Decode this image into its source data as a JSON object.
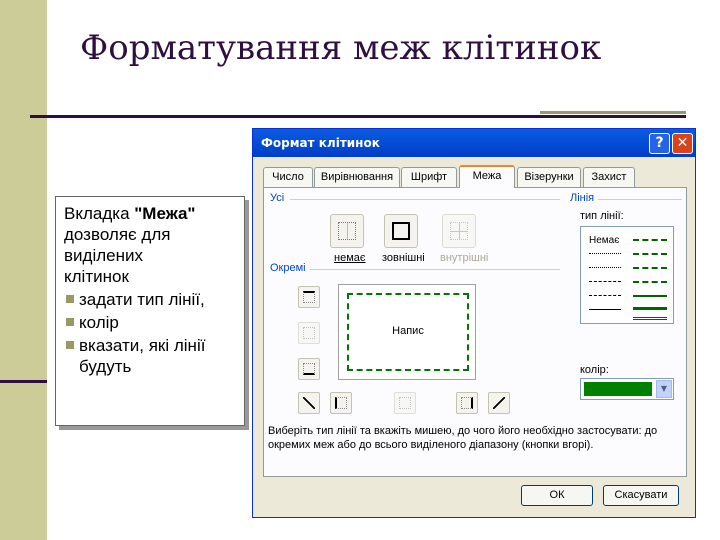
{
  "slide": {
    "title": "Форматування меж клітинок",
    "text_lines": [
      "Вкладка \"Межа\"",
      "дозволяє для",
      "виділених",
      "клітинок"
    ],
    "bullets": [
      "задати тип лінії,",
      "колір",
      "вказати, які лінії будуть"
    ]
  },
  "dialog": {
    "title": "Формат клітинок",
    "help": "?",
    "close": "✕",
    "tabs": [
      "Число",
      "Вирівнювання",
      "Шрифт",
      "Межа",
      "Візерунки",
      "Захист"
    ],
    "active_tab": "Межа",
    "group_all": "Усі",
    "group_separate": "Окремі",
    "group_line": "Лінія",
    "presets": [
      "немає",
      "зовнішні",
      "внутрішні"
    ],
    "preview_text": "Напис",
    "line_type_label": "тип лінії:",
    "line_none": "Немає",
    "color_label": "колір:",
    "color_value": "#008000",
    "hint": "Виберіть тип лінії та вкажіть мишею, до чого його необхідно застосувати: до окремих меж або до всього виділеного діапазону (кнопки вгорі).",
    "ok": "ОК",
    "cancel": "Скасувати"
  },
  "colors": {
    "accent": "#2e1040",
    "sidebar": "#cccc99",
    "title_bar": "#0a5ce0"
  }
}
